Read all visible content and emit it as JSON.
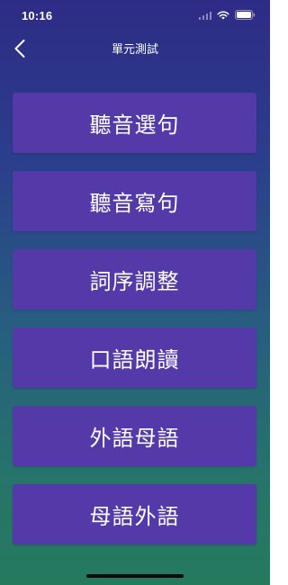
{
  "status_bar": {
    "time": "10:16",
    "icons": [
      "signal-icon",
      "wifi-icon",
      "battery-icon"
    ]
  },
  "nav": {
    "back_icon": "chevron-left-icon",
    "title": "單元測試"
  },
  "menu": {
    "items": [
      {
        "label": "聽音選句"
      },
      {
        "label": "聽音寫句"
      },
      {
        "label": "詞序調整"
      },
      {
        "label": "口語朗讀"
      },
      {
        "label": "外語母語"
      },
      {
        "label": "母語外語"
      }
    ]
  },
  "colors": {
    "background_top": "#2e2b86",
    "background_bottom": "#257a5d",
    "button": "#5439a8",
    "text": "#ffffff"
  }
}
